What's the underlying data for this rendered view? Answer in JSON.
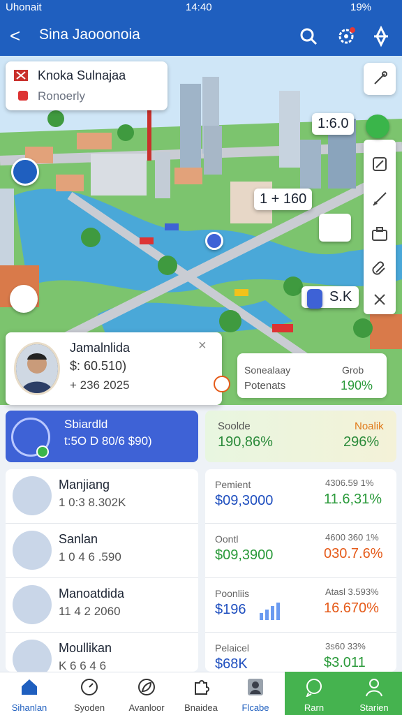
{
  "status": {
    "carrier": "Uhonait",
    "time": "14:40",
    "battery": "19%"
  },
  "header": {
    "back": "<",
    "title": "Sina Jaooonoia",
    "icons": [
      "search-icon",
      "settings-icon",
      "compass-icon"
    ]
  },
  "map": {
    "location_name": "Knoka Sulnajaa",
    "location_sub": "Ronoerly",
    "bubble_1": "1:6.0",
    "bubble_2": "1 + 160",
    "bubble_3": "S.K",
    "tools": [
      "edit-icon",
      "pen-icon",
      "briefcase-icon",
      "clip-icon",
      "expand-icon"
    ],
    "accent": "#1f5fbf"
  },
  "profile": {
    "name": "Jamalnlida",
    "line1": "$: 60.510)",
    "line2": "+ 236 2025",
    "close": "×"
  },
  "info": {
    "left_label": "Sonealaay",
    "left_value": "Potenats",
    "right_label": "Grob",
    "right_value": "190%"
  },
  "stats": {
    "blue_title": "Sbiardld",
    "blue_value": "t:5O D 80/6 $90)",
    "green_left_label": "Soolde",
    "green_left_value": "190,86%",
    "green_right_label": "Noalik",
    "green_right_value": "296%"
  },
  "people": [
    {
      "name": "Manjiang",
      "value": "1 0:3 8.302K"
    },
    {
      "name": "Sanlan",
      "value": "1 0 4 6 .590"
    },
    {
      "name": "Manoatdida",
      "value": "11 4 2 2060"
    },
    {
      "name": "Moullikan",
      "value": "K 6 6 4 6"
    }
  ],
  "finance": [
    {
      "label": "Pemient",
      "value": "$09,3000",
      "right_label": "4306.59 1%",
      "right_value": "11.6,31%",
      "value_color": "#1f4fbf",
      "right_color": "#2a9a3a"
    },
    {
      "label": "Oontl",
      "value": "$09,3900",
      "right_label": "4600 360 1%",
      "right_value": "030.7.6%",
      "value_color": "#2a9a3a",
      "right_color": "#e55b1a"
    },
    {
      "label": "Poonliis",
      "value": "$196",
      "right_label": "Atasl 3.593%",
      "right_value": "16.670%",
      "value_color": "#1f4fbf",
      "right_color": "#e55b1a"
    },
    {
      "label": "Pelaicel",
      "value": "$68K",
      "right_label": "3s60 33%",
      "right_value": "$3.011",
      "value_color": "#1f4fbf",
      "right_color": "#2a9a3a"
    }
  ],
  "nav": [
    {
      "label": "Sihanlan",
      "icon": "home-icon"
    },
    {
      "label": "Syoden",
      "icon": "clock-icon"
    },
    {
      "label": "Avanloor",
      "icon": "leaf-icon"
    },
    {
      "label": "Bnaidea",
      "icon": "puzzle-icon"
    },
    {
      "label": "Flcabe",
      "icon": "portrait-icon"
    },
    {
      "label": "Rarn",
      "icon": "chat-icon"
    },
    {
      "label": "Starien",
      "icon": "user-icon"
    }
  ]
}
